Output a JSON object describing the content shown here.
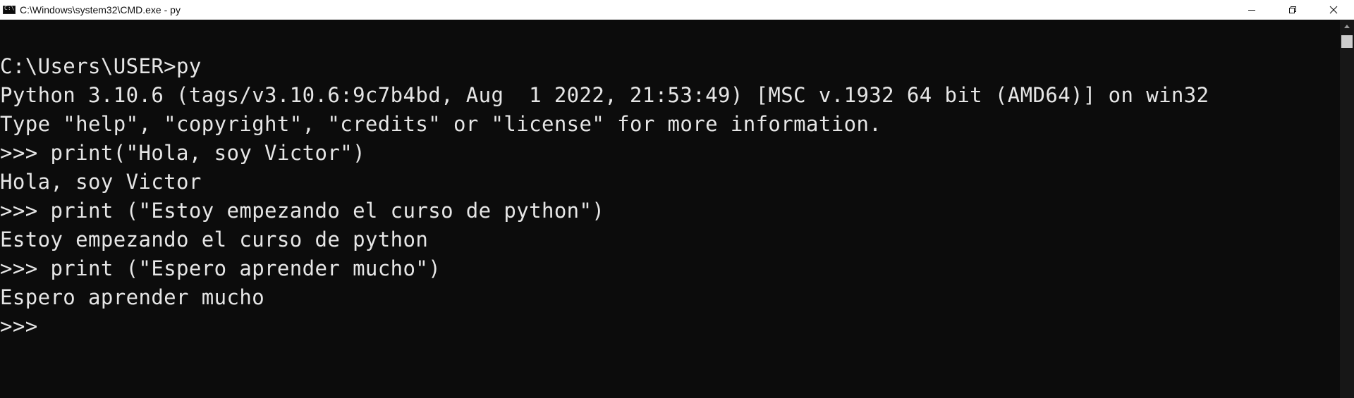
{
  "window": {
    "title": "C:\\Windows\\system32\\CMD.exe - py",
    "app_icon": "console-icon",
    "controls": {
      "minimize_icon": "minimize-icon",
      "restore_icon": "restore-icon",
      "close_icon": "close-icon"
    }
  },
  "console": {
    "lines": [
      "C:\\Users\\USER>py",
      "Python 3.10.6 (tags/v3.10.6:9c7b4bd, Aug  1 2022, 21:53:49) [MSC v.1932 64 bit (AMD64)] on win32",
      "Type \"help\", \"copyright\", \"credits\" or \"license\" for more information.",
      ">>> print(\"Hola, soy Victor\")",
      "Hola, soy Victor",
      ">>> print (\"Estoy empezando el curso de python\")",
      "Estoy empezando el curso de python",
      ">>> print (\"Espero aprender mucho\")",
      "Espero aprender mucho",
      ">>> "
    ],
    "colors": {
      "background": "#0c0c0c",
      "text": "#e6e6e6"
    }
  },
  "scrollbar": {
    "up_icon": "scroll-up-arrow-icon"
  }
}
